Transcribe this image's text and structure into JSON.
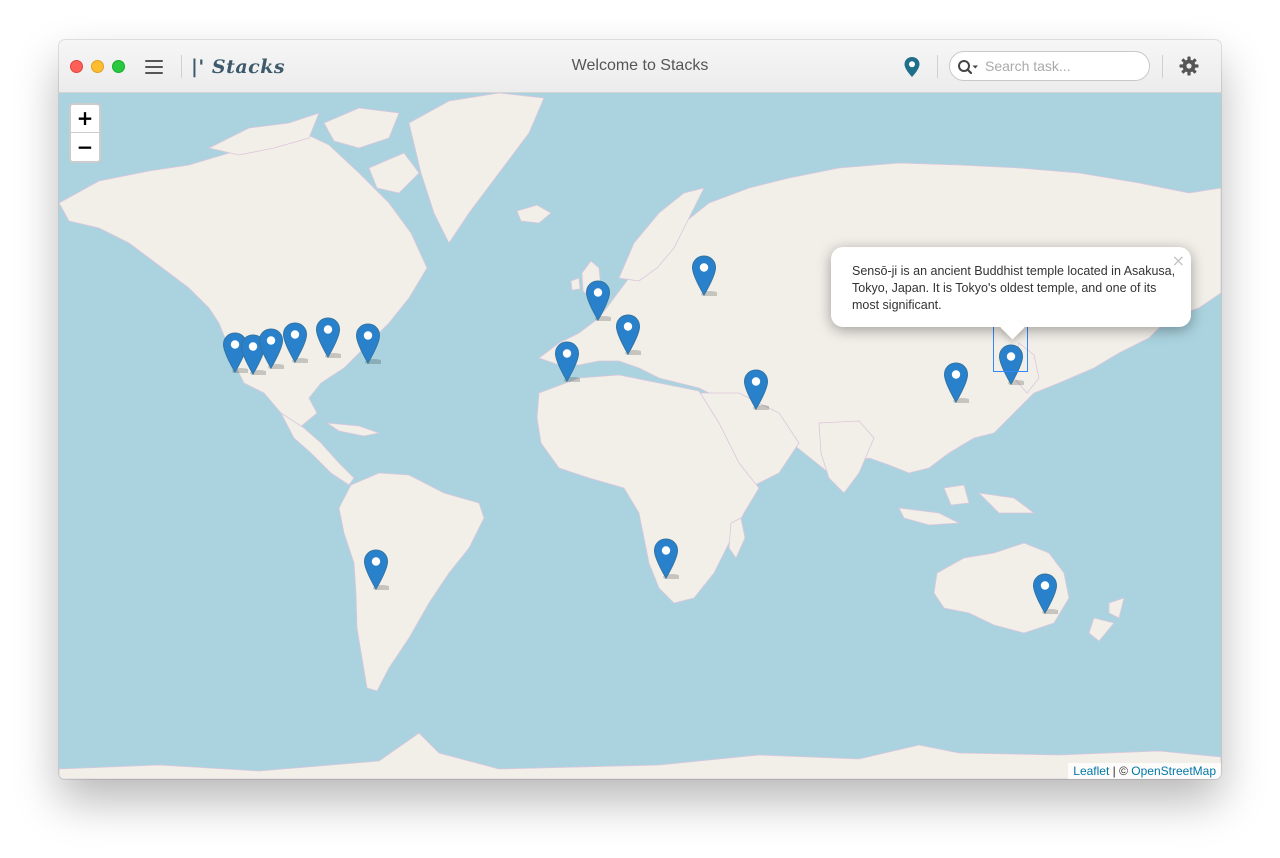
{
  "app": {
    "title": "Welcome to Stacks",
    "logo_text": "Stacks"
  },
  "toolbar": {
    "menu_icon": "hamburger-icon",
    "location_icon": "map-pin-icon",
    "search": {
      "placeholder": "Search task...",
      "value": ""
    },
    "settings_icon": "gear-icon"
  },
  "map": {
    "zoom_in_label": "+",
    "zoom_out_label": "−",
    "marker_count": 17,
    "popup": {
      "text": "Sensō-ji is an ancient Buddhist temple located in Asakusa, Tokyo, Japan. It is Tokyo's oldest temple, and one of its most significant.",
      "close_label": "×"
    },
    "attribution": {
      "leaflet_label": "Leaflet",
      "separator": " | © ",
      "osm_label": "OpenStreetMap"
    }
  },
  "colors": {
    "water": "#aad3df",
    "land": "#f2efe9",
    "marker": "#2a81cb",
    "accent": "#1f6f8b"
  }
}
